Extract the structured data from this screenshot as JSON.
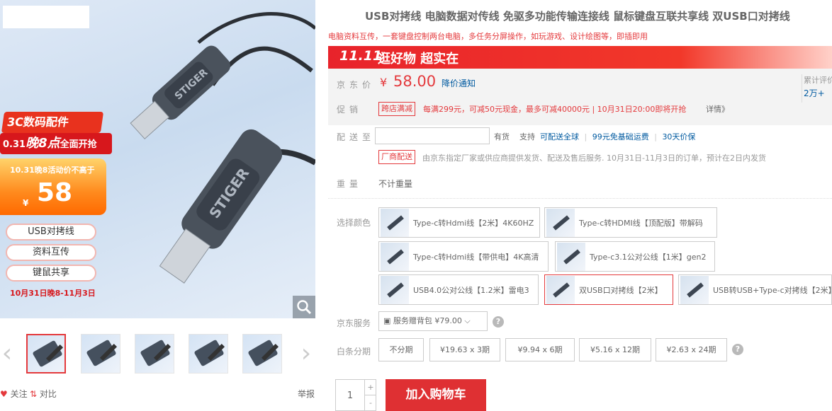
{
  "gallery": {
    "promo_line1": "3C数码配件11.11",
    "promo_line2_prefix": "0.31",
    "promo_line2_big": "晚8点",
    "promo_line2_suffix": "全面开抢",
    "price_caption": "10.31晚8活动价不高于",
    "price_yen": "¥",
    "price_value": "58",
    "features": [
      "USB对拷线",
      "资料互传",
      "键鼠共享"
    ],
    "date_tag": "10月31日晚8-11月3日",
    "brand_text": "STIGER",
    "thumb_count": 5
  },
  "bottom_tools": {
    "follow": "关注",
    "compare": "对比",
    "report": "举报"
  },
  "product": {
    "title": "USB对拷线 电脑数据对传线 免驱多功能传输连接线 鼠标键盘互联共享线 双USB口对拷线",
    "subtitle": "电脑资料互传，一套键盘控制两台电脑，多任务分屏操作，如玩游戏、设计绘图等，即插即用"
  },
  "banner": {
    "logo": "11.11",
    "slogan": "逛好物 超实在"
  },
  "price": {
    "label": "京东价",
    "yen": "¥",
    "value": "58.00",
    "notify": "降价通知",
    "cumulative_label": "累计评价",
    "cumulative_count": "2万+"
  },
  "promotion": {
    "label": "促销",
    "tag": "跨店满减",
    "text": "每满299元，可减50元现金，最多可减40000元 | 10月31日20:00即将开抢",
    "more": "详情》"
  },
  "delivery": {
    "label": "配送至",
    "stock": "有货",
    "support_label": "支持",
    "support_items": [
      "可配送全球",
      "99元免基础运费",
      "30天价保"
    ],
    "vendor_tag": "厂商配送",
    "vendor_text": "由京东指定厂家或供应商提供发货、配送及售后服务. 10月31日-11月3日的订单，预计在2日内发货"
  },
  "weight": {
    "label": "重量",
    "value": "不计重量"
  },
  "colors": {
    "label": "选择颜色",
    "options": [
      "Type-c转Hdmi线【2米】4K60HZ",
      "Type-c转HDMI线【顶配版】带解码",
      "Type-c转Hdmi线【带供电】4K高清",
      "Type-c3.1公对公线【1米】gen2",
      "USB4.0公对公线【1.2米】雷电3",
      "双USB口对拷线【2米】",
      "USB转USB+Type-c对拷线【2米】"
    ],
    "selected": "双USB口对拷线【2米】"
  },
  "service": {
    "label": "京东服务",
    "value": "服务赠背包 ¥79.00"
  },
  "installment": {
    "label": "白条分期",
    "options": [
      "不分期",
      "¥19.63 x 3期",
      "¥9.94 x 6期",
      "¥5.16 x 12期",
      "¥2.63 x 24期"
    ]
  },
  "cart": {
    "quantity": "1",
    "plus": "+",
    "minus": "-",
    "button": "加入购物车"
  },
  "colors_accent": {
    "jd_red": "#e4393c",
    "link_blue": "#005aa0"
  }
}
